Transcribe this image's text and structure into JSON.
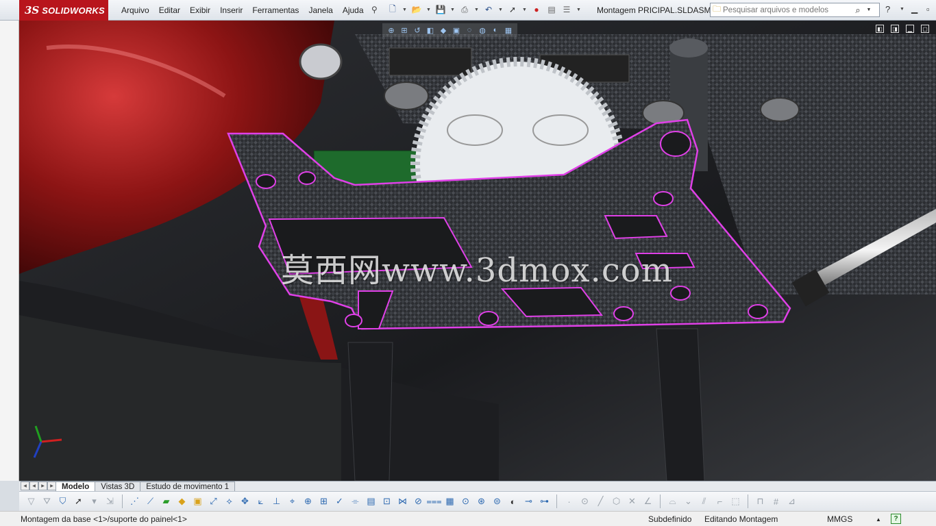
{
  "app": {
    "logo_mark": "3S",
    "logo_text": "SOLIDWORKS",
    "document_title": "Montagem PRICIPAL.SLDASM *"
  },
  "menu": {
    "items": [
      "Arquivo",
      "Editar",
      "Exibir",
      "Inserir",
      "Ferramentas",
      "Janela",
      "Ajuda"
    ]
  },
  "search": {
    "placeholder": "Pesquisar arquivos e modelos"
  },
  "viewport": {
    "watermark": "莫西网www.3dmox.com",
    "highlight_color": "#e040e8",
    "triad_colors": {
      "x": "#d02020",
      "y": "#20a020",
      "z": "#2040c0"
    }
  },
  "tabs": {
    "items": [
      "Modelo",
      "Vistas 3D",
      "Estudo de movimento 1"
    ],
    "active": "Modelo"
  },
  "status": {
    "selection": "Montagem da base <1>/suporte do painel<1>",
    "definition": "Subdefinido",
    "mode": "Editando Montagem",
    "units": "MMGS",
    "units_arrow": "▲",
    "help_label": "?"
  },
  "icons": {
    "new": "new-document-icon",
    "open": "open-folder-icon",
    "save": "save-icon",
    "print": "print-icon",
    "undo": "undo-icon",
    "select": "select-cursor-icon",
    "rebuild": "rebuild-traffic-light-icon",
    "options": "options-icon",
    "search": "search-icon",
    "help": "help-icon"
  },
  "colors": {
    "brand_red": "#b8151c",
    "carbon_dark": "#2a2c30",
    "gear_white": "#e9ecef"
  }
}
